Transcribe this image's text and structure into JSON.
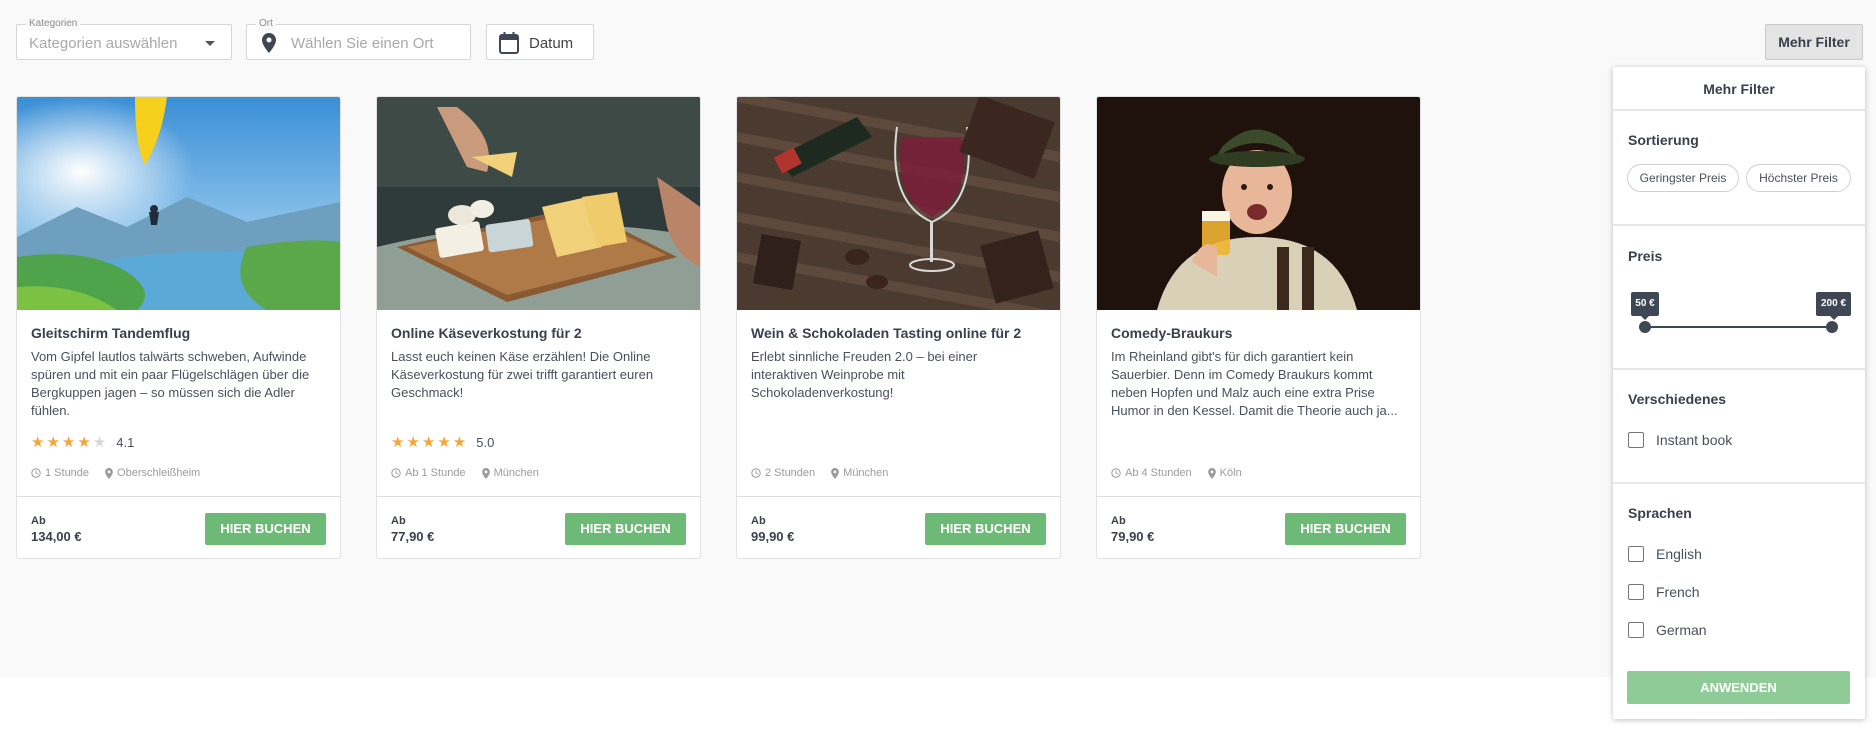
{
  "filters": {
    "kategorien_label": "Kategorien",
    "kategorien_placeholder": "Kategorien auswählen",
    "ort_label": "Ort",
    "ort_placeholder": "Wählen Sie einen Ort",
    "datum_label": "Datum",
    "mehr_filter_button": "Mehr Filter"
  },
  "cards": [
    {
      "title": "Gleitschirm Tandemflug",
      "description": "Vom Gipfel lautlos talwärts schweben, Aufwinde spüren und mit ein paar Flügelschlägen über die Bergkuppen jagen – so müssen sich die Adler fühlen.",
      "rating": "4.1",
      "stars": 4,
      "duration": "1 Stunde",
      "location": "Oberschleißheim",
      "price_from": "Ab",
      "price": "134,00 €",
      "book_label": "HIER BUCHEN"
    },
    {
      "title": "Online Käseverkostung für 2",
      "description": "Lasst euch keinen Käse erzählen! Die Online Käseverkostung für zwei trifft garantiert euren Geschmack!",
      "rating": "5.0",
      "stars": 5,
      "duration": "Ab 1 Stunde",
      "location": "München",
      "price_from": "Ab",
      "price": "77,90 €",
      "book_label": "HIER BUCHEN"
    },
    {
      "title": "Wein & Schokoladen Tasting online für 2",
      "description": "Erlebt sinnliche Freuden 2.0 – bei einer interaktiven Weinprobe mit Schokoladenverkostung!",
      "duration": "2 Stunden",
      "location": "München",
      "price_from": "Ab",
      "price": "99,90 €",
      "book_label": "HIER BUCHEN"
    },
    {
      "title": "Comedy-Braukurs",
      "description": "Im Rheinland gibt's für dich garantiert kein Sauerbier. Denn im Comedy Braukurs kommt neben Hopfen und Malz auch eine extra Prise Humor in den Kessel. Damit die Theorie auch ja...",
      "duration": "Ab 4 Stunden",
      "location": "Köln",
      "price_from": "Ab",
      "price": "79,90 €",
      "book_label": "HIER BUCHEN"
    }
  ],
  "panel": {
    "title": "Mehr Filter",
    "sortierung_title": "Sortierung",
    "sort_low": "Geringster Preis",
    "sort_high": "Höchster Preis",
    "preis_title": "Preis",
    "price_min": "50 €",
    "price_max": "200 €",
    "verschiedenes_title": "Verschiedenes",
    "instant_book": "Instant book",
    "sprachen_title": "Sprachen",
    "languages": [
      "English",
      "French",
      "German"
    ],
    "apply": "ANWENDEN"
  },
  "colors": {
    "book_button": "#6cba75",
    "apply_button": "#8fcb96",
    "star": "#f5a63a",
    "slider": "#3f4654"
  }
}
